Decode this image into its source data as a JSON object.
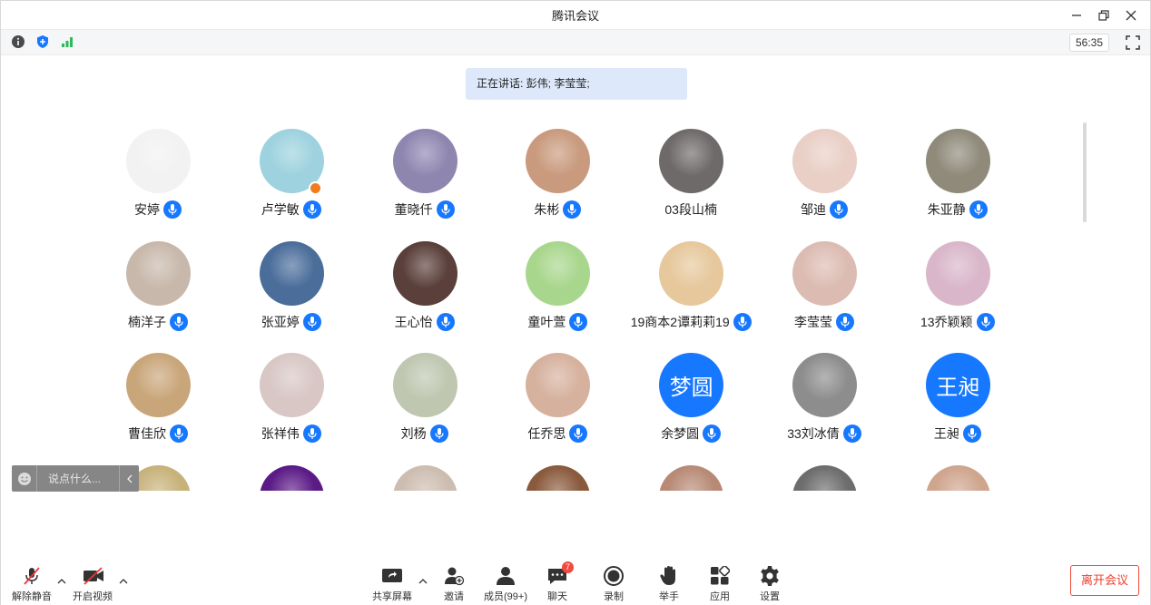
{
  "window": {
    "title": "腾讯会议"
  },
  "infobar": {
    "timer": "56:35"
  },
  "speaking": {
    "text": "正在讲话: 彭伟; 李莹莹;"
  },
  "participants": [
    {
      "name": "安婷",
      "mic": true,
      "avatar_color": "#f2f2f2"
    },
    {
      "name": "卢学敏",
      "mic": true,
      "avatar_color": "#9dd2de",
      "host": true
    },
    {
      "name": "董晓仟",
      "mic": true,
      "avatar_color": "#8f86b0"
    },
    {
      "name": "朱彬",
      "mic": true,
      "avatar_color": "#c99a7d"
    },
    {
      "name": "03段山楠",
      "mic": false,
      "avatar_color": "#6f6a6a"
    },
    {
      "name": "邹迪",
      "mic": true,
      "avatar_color": "#e9cfc6"
    },
    {
      "name": "朱亚静",
      "mic": true,
      "avatar_color": "#8f8a7a"
    },
    {
      "name": "楠洋子",
      "mic": true,
      "avatar_color": "#c8b8ab"
    },
    {
      "name": "张亚婷",
      "mic": true,
      "avatar_color": "#4a6d9a"
    },
    {
      "name": "王心怡",
      "mic": true,
      "avatar_color": "#5a3f3a"
    },
    {
      "name": "童叶萱",
      "mic": true,
      "avatar_color": "#a8d68c"
    },
    {
      "name": "19商本2谭莉莉19",
      "mic": true,
      "avatar_color": "#e6c89c"
    },
    {
      "name": "李莹莹",
      "mic": true,
      "avatar_color": "#dcbcb2"
    },
    {
      "name": "13乔颖颖",
      "mic": true,
      "avatar_color": "#d9b6c9"
    },
    {
      "name": "曹佳欣",
      "mic": true,
      "avatar_color": "#c9a67a"
    },
    {
      "name": "张祥伟",
      "mic": true,
      "avatar_color": "#d8c7c5"
    },
    {
      "name": "刘杨",
      "mic": true,
      "avatar_color": "#bfc7b1"
    },
    {
      "name": "任乔思",
      "mic": true,
      "avatar_color": "#d6b19e"
    },
    {
      "name": "余梦圆",
      "mic": true,
      "avatar_text": "梦圆"
    },
    {
      "name": "33刘冰倩",
      "mic": true,
      "avatar_color": "#8d8d8d"
    },
    {
      "name": "王昶",
      "mic": true,
      "avatar_text": "王昶"
    },
    {
      "name": "",
      "mic": false,
      "avatar_color": "#c7b27a"
    },
    {
      "name": "",
      "mic": false,
      "avatar_color": "#5b1a86"
    },
    {
      "name": "",
      "mic": false,
      "avatar_color": "#cdbdb0"
    },
    {
      "name": "",
      "mic": false,
      "avatar_color": "#8a5a3d"
    },
    {
      "name": "",
      "mic": false,
      "avatar_color": "#b88a76"
    },
    {
      "name": "",
      "mic": false,
      "avatar_color": "#6d6d6d"
    },
    {
      "name": "",
      "mic": false,
      "avatar_color": "#cfa58e"
    }
  ],
  "chat": {
    "placeholder": "说点什么..."
  },
  "toolbar": {
    "unmute": "解除静音",
    "start_video": "开启视频",
    "share_screen": "共享屏幕",
    "invite": "邀请",
    "members": "成员(99+)",
    "chat": "聊天",
    "chat_badge": "7",
    "record": "录制",
    "raise_hand": "举手",
    "apps": "应用",
    "settings": "设置",
    "leave": "离开会议"
  },
  "colors": {
    "accent": "#1677ff",
    "danger": "#ef3b2c"
  }
}
